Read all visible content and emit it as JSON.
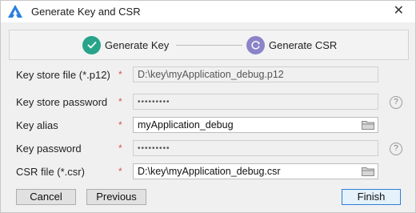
{
  "window": {
    "title": "Generate Key and CSR",
    "icon": "app-logo-icon"
  },
  "steps": [
    {
      "label": "Generate Key",
      "state": "done",
      "icon": "check-icon",
      "color": "#27a48a"
    },
    {
      "label": "Generate CSR",
      "state": "current",
      "icon": "refresh-icon",
      "color": "#8b84c8"
    }
  ],
  "form": {
    "required_mark": "*",
    "key_store_file": {
      "label": "Key store file (*.p12)",
      "value": "D:\\key\\myApplication_debug.p12"
    },
    "key_store_password": {
      "label": "Key store password",
      "value": "•••••••••"
    },
    "key_alias": {
      "label": "Key alias",
      "value": "myApplication_debug"
    },
    "key_password": {
      "label": "Key password",
      "value": "•••••••••"
    },
    "csr_file": {
      "label": "CSR file (*.csr)",
      "value": "D:\\key\\myApplication_debug.csr"
    },
    "help_glyph": "?"
  },
  "buttons": {
    "cancel": "Cancel",
    "previous": "Previous",
    "finish": "Finish"
  },
  "colors": {
    "required": "#d9534f",
    "finish_border": "#2f7fd9"
  }
}
